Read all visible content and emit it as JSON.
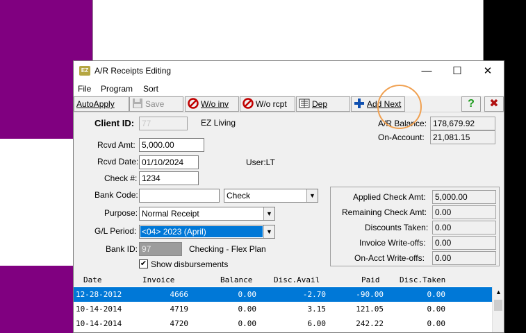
{
  "window": {
    "title": "A/R Receipts Editing",
    "app_icon_text": "EZ",
    "minimize_glyph": "—",
    "maximize_glyph": "☐",
    "close_glyph": "✕"
  },
  "menu": [
    "File",
    "Program",
    "Sort"
  ],
  "toolbar": {
    "autoapply": "AutoApply",
    "save": "Save",
    "wo_inv": "W/o inv",
    "wo_rcpt": "W/o rcpt",
    "dep": "Dep",
    "add_next": "Add Next",
    "help_glyph": "?",
    "cancel_glyph": "✖"
  },
  "form": {
    "client_id_label": "Client ID:",
    "client_id_value": "77",
    "client_name": "EZ Living",
    "ar_balance_label": "A/R Balance:",
    "ar_balance_value": "178,679.92",
    "on_account_label": "On-Account:",
    "on_account_value": "21,081.15",
    "rcvd_amt_label": "Rcvd Amt:",
    "rcvd_amt_value": "5,000.00",
    "rcvd_date_label": "Rcvd Date:",
    "rcvd_date_value": "01/10/2024",
    "user_text": "User:LT",
    "check_no_label": "Check #:",
    "check_no_value": "1234",
    "bank_code_label": "Bank Code:",
    "bank_code_value": "",
    "payment_type_value": "Check",
    "purpose_label": "Purpose:",
    "purpose_value": "Normal Receipt",
    "gl_period_label": "G/L Period:",
    "gl_period_value": "<04> 2023 (April)",
    "bank_id_label": "Bank ID:",
    "bank_id_value": "97",
    "bank_name": "Checking - Flex Plan",
    "show_disb_label": "Show disbursements",
    "show_disb_checked": "✔"
  },
  "summary": {
    "applied_label": "Applied Check Amt:",
    "applied_value": "5,000.00",
    "remaining_label": "Remaining Check Amt:",
    "remaining_value": "0.00",
    "discounts_label": "Discounts Taken:",
    "discounts_value": "0.00",
    "inv_wo_label": "Invoice Write-offs:",
    "inv_wo_value": "0.00",
    "onacct_wo_label": "On-Acct Write-offs:",
    "onacct_wo_value": "0.00"
  },
  "grid": {
    "headers": [
      "Date",
      "Invoice",
      "Balance",
      "Disc.Avail",
      "Paid",
      "Disc.Taken"
    ],
    "rows": [
      [
        "12-28-2012",
        "4666",
        "0.00",
        "-2.70",
        "-90.00",
        "0.00"
      ],
      [
        "10-14-2014",
        "4719",
        "0.00",
        "3.15",
        "121.05",
        "0.00"
      ],
      [
        "10-14-2014",
        "4720",
        "0.00",
        "6.00",
        "242.22",
        "0.00"
      ]
    ]
  },
  "colors": {
    "desktop_purple": "#800080",
    "selection_blue": "#0078d7",
    "highlight_orange": "#f0a050"
  }
}
